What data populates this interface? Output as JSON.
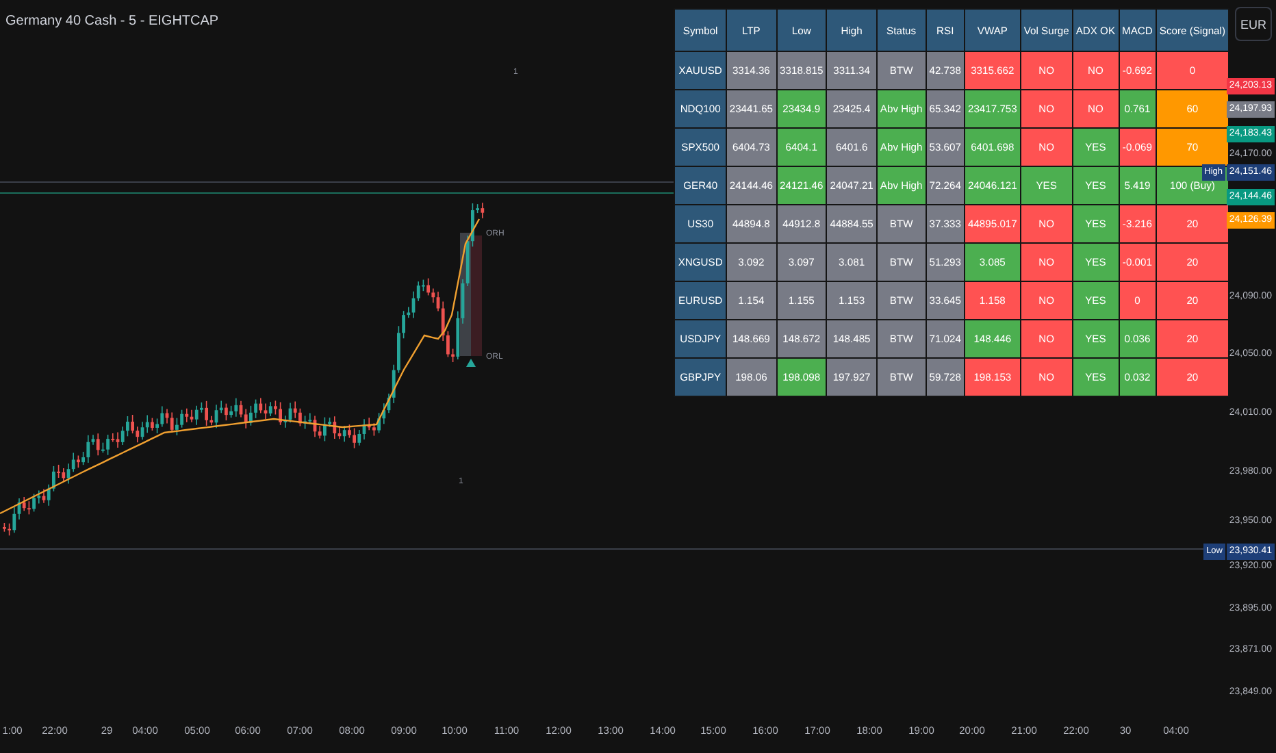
{
  "chart": {
    "title": "Germany 40 Cash - 5 - EIGHTCAP",
    "currency_button": "EUR",
    "markers": [
      {
        "text": "1"
      },
      {
        "text": "ORH"
      },
      {
        "text": "ORL"
      },
      {
        "text": "1"
      }
    ]
  },
  "table": {
    "columns": [
      "Symbol",
      "LTP",
      "Low",
      "High",
      "Status",
      "RSI",
      "VWAP",
      "Vol Surge",
      "ADX OK",
      "MACD",
      "Score (Signal)"
    ],
    "rows": [
      {
        "cells": [
          {
            "text": "XAUUSD"
          },
          {
            "text": "3314.36",
            "color": "#787b86"
          },
          {
            "text": "3318.815",
            "color": "#787b86"
          },
          {
            "text": "3311.34",
            "color": "#787b86"
          },
          {
            "text": "BTW",
            "color": "#787b86"
          },
          {
            "text": "42.738",
            "color": "#787b86"
          },
          {
            "text": "3315.662",
            "color": "#ff5252"
          },
          {
            "text": "NO",
            "color": "#ff5252"
          },
          {
            "text": "NO",
            "color": "#ff5252"
          },
          {
            "text": "-0.692",
            "color": "#ff5252"
          },
          {
            "text": "0",
            "color": "#ff5252"
          }
        ]
      },
      {
        "cells": [
          {
            "text": "NDQ100"
          },
          {
            "text": "23441.65",
            "color": "#787b86"
          },
          {
            "text": "23434.9",
            "color": "#4caf50"
          },
          {
            "text": "23425.4",
            "color": "#787b86"
          },
          {
            "text": "Abv High",
            "color": "#4caf50"
          },
          {
            "text": "65.342",
            "color": "#787b86"
          },
          {
            "text": "23417.753",
            "color": "#4caf50"
          },
          {
            "text": "NO",
            "color": "#ff5252"
          },
          {
            "text": "NO",
            "color": "#ff5252"
          },
          {
            "text": "0.761",
            "color": "#4caf50"
          },
          {
            "text": "60",
            "color": "#ff9800"
          }
        ]
      },
      {
        "cells": [
          {
            "text": "SPX500"
          },
          {
            "text": "6404.73",
            "color": "#787b86"
          },
          {
            "text": "6404.1",
            "color": "#4caf50"
          },
          {
            "text": "6401.6",
            "color": "#787b86"
          },
          {
            "text": "Abv High",
            "color": "#4caf50"
          },
          {
            "text": "53.607",
            "color": "#787b86"
          },
          {
            "text": "6401.698",
            "color": "#4caf50"
          },
          {
            "text": "NO",
            "color": "#ff5252"
          },
          {
            "text": "YES",
            "color": "#4caf50"
          },
          {
            "text": "-0.069",
            "color": "#ff5252"
          },
          {
            "text": "70",
            "color": "#ff9800"
          }
        ]
      },
      {
        "cells": [
          {
            "text": "GER40"
          },
          {
            "text": "24144.46",
            "color": "#787b86"
          },
          {
            "text": "24121.46",
            "color": "#4caf50"
          },
          {
            "text": "24047.21",
            "color": "#787b86"
          },
          {
            "text": "Abv High",
            "color": "#4caf50"
          },
          {
            "text": "72.264",
            "color": "#787b86"
          },
          {
            "text": "24046.121",
            "color": "#4caf50"
          },
          {
            "text": "YES",
            "color": "#4caf50"
          },
          {
            "text": "YES",
            "color": "#4caf50"
          },
          {
            "text": "5.419",
            "color": "#4caf50"
          },
          {
            "text": "100 (Buy)",
            "color": "#4caf50"
          }
        ]
      },
      {
        "cells": [
          {
            "text": "US30"
          },
          {
            "text": "44894.8",
            "color": "#787b86"
          },
          {
            "text": "44912.8",
            "color": "#787b86"
          },
          {
            "text": "44884.55",
            "color": "#787b86"
          },
          {
            "text": "BTW",
            "color": "#787b86"
          },
          {
            "text": "37.333",
            "color": "#787b86"
          },
          {
            "text": "44895.017",
            "color": "#ff5252"
          },
          {
            "text": "NO",
            "color": "#ff5252"
          },
          {
            "text": "YES",
            "color": "#4caf50"
          },
          {
            "text": "-3.216",
            "color": "#ff5252"
          },
          {
            "text": "20",
            "color": "#ff5252"
          }
        ]
      },
      {
        "cells": [
          {
            "text": "XNGUSD"
          },
          {
            "text": "3.092",
            "color": "#787b86"
          },
          {
            "text": "3.097",
            "color": "#787b86"
          },
          {
            "text": "3.081",
            "color": "#787b86"
          },
          {
            "text": "BTW",
            "color": "#787b86"
          },
          {
            "text": "51.293",
            "color": "#787b86"
          },
          {
            "text": "3.085",
            "color": "#4caf50"
          },
          {
            "text": "NO",
            "color": "#ff5252"
          },
          {
            "text": "YES",
            "color": "#4caf50"
          },
          {
            "text": "-0.001",
            "color": "#ff5252"
          },
          {
            "text": "20",
            "color": "#ff5252"
          }
        ]
      },
      {
        "cells": [
          {
            "text": "EURUSD"
          },
          {
            "text": "1.154",
            "color": "#787b86"
          },
          {
            "text": "1.155",
            "color": "#787b86"
          },
          {
            "text": "1.153",
            "color": "#787b86"
          },
          {
            "text": "BTW",
            "color": "#787b86"
          },
          {
            "text": "33.645",
            "color": "#787b86"
          },
          {
            "text": "1.158",
            "color": "#ff5252"
          },
          {
            "text": "NO",
            "color": "#ff5252"
          },
          {
            "text": "YES",
            "color": "#4caf50"
          },
          {
            "text": "0",
            "color": "#ff5252"
          },
          {
            "text": "20",
            "color": "#ff5252"
          }
        ]
      },
      {
        "cells": [
          {
            "text": "USDJPY"
          },
          {
            "text": "148.669",
            "color": "#787b86"
          },
          {
            "text": "148.672",
            "color": "#787b86"
          },
          {
            "text": "148.485",
            "color": "#787b86"
          },
          {
            "text": "BTW",
            "color": "#787b86"
          },
          {
            "text": "71.024",
            "color": "#787b86"
          },
          {
            "text": "148.446",
            "color": "#4caf50"
          },
          {
            "text": "NO",
            "color": "#ff5252"
          },
          {
            "text": "YES",
            "color": "#4caf50"
          },
          {
            "text": "0.036",
            "color": "#4caf50"
          },
          {
            "text": "20",
            "color": "#ff5252"
          }
        ]
      },
      {
        "cells": [
          {
            "text": "GBPJPY"
          },
          {
            "text": "198.06",
            "color": "#787b86"
          },
          {
            "text": "198.098",
            "color": "#4caf50"
          },
          {
            "text": "197.927",
            "color": "#787b86"
          },
          {
            "text": "BTW",
            "color": "#787b86"
          },
          {
            "text": "59.728",
            "color": "#787b86"
          },
          {
            "text": "198.153",
            "color": "#ff5252"
          },
          {
            "text": "NO",
            "color": "#ff5252"
          },
          {
            "text": "YES",
            "color": "#4caf50"
          },
          {
            "text": "0.032",
            "color": "#4caf50"
          },
          {
            "text": "20",
            "color": "#ff5252"
          }
        ]
      }
    ]
  },
  "price_axis": [
    {
      "text": "24,203.13",
      "color": "#f23645"
    },
    {
      "text": "24,197.93",
      "color": "#787b86"
    },
    {
      "text": "24,183.43",
      "color": "#089981"
    },
    {
      "text": "24,170.00"
    },
    {
      "tag": "High",
      "text": "24,151.46",
      "color": "#1e3f78"
    },
    {
      "text": "24,144.46",
      "color": "#089981"
    },
    {
      "text": "24,126.39",
      "color": "#ff9800"
    },
    {
      "text": "24,090.00"
    },
    {
      "text": "24,050.00"
    },
    {
      "text": "24,010.00"
    },
    {
      "text": "23,980.00"
    },
    {
      "text": "23,950.00"
    },
    {
      "tag": "Low",
      "text": "23,930.41",
      "color": "#1e3f78"
    },
    {
      "text": "23,920.00"
    },
    {
      "text": "23,895.00"
    },
    {
      "text": "23,871.00"
    },
    {
      "text": "23,849.00"
    }
  ],
  "time_axis": [
    "1:00",
    "22:00",
    "29",
    "04:00",
    "05:00",
    "06:00",
    "07:00",
    "08:00",
    "09:00",
    "10:00",
    "11:00",
    "12:00",
    "13:00",
    "14:00",
    "15:00",
    "16:00",
    "17:00",
    "18:00",
    "19:00",
    "20:00",
    "21:00",
    "22:00",
    "30",
    "04:00"
  ]
}
